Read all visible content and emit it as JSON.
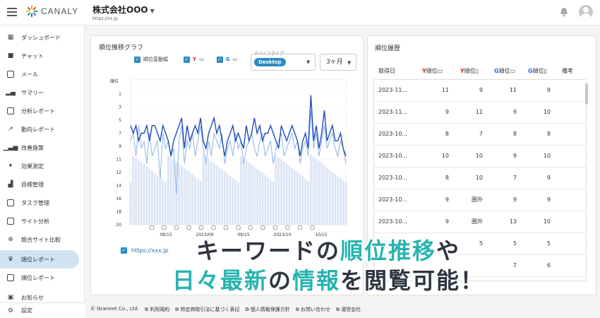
{
  "header": {
    "brand": "CANALY",
    "company": "株式会社OOO",
    "url": "https://xx.jp"
  },
  "sidebar": {
    "items": [
      {
        "label": "ダッシュボード",
        "icon": "grid-icon"
      },
      {
        "label": "チャット",
        "icon": "chat-icon"
      },
      {
        "label": "メール",
        "icon": "mail-icon"
      },
      {
        "label": "サマリー",
        "icon": "bar-chart-icon"
      },
      {
        "label": "分析レポート",
        "icon": "report-icon"
      },
      {
        "label": "動向レポート",
        "icon": "trend-icon"
      },
      {
        "label": "改善施策",
        "icon": "improve-icon"
      },
      {
        "label": "効果測定",
        "icon": "measure-icon"
      },
      {
        "label": "目標管理",
        "icon": "goal-icon"
      },
      {
        "label": "タスク管理",
        "icon": "task-icon"
      },
      {
        "label": "サイト分析",
        "icon": "site-icon"
      },
      {
        "label": "競合サイト比較",
        "icon": "compare-icon"
      },
      {
        "label": "順位レポート",
        "icon": "crown-icon",
        "active": true
      },
      {
        "label": "順位レポート",
        "icon": "edit-icon"
      },
      {
        "label": "お知らせ",
        "icon": "notice-icon"
      }
    ],
    "settings": "設定"
  },
  "rank_chart_card": {
    "title": "順位推移グラフ",
    "legend": {
      "rank_range": "順位変動幅",
      "yahoo_mark": "Y",
      "google_mark": "G"
    },
    "device_label": "デバイスタイプ",
    "device_value": "Desktop",
    "period_value": "3ヶ月",
    "series_url": "https://xxx.jp"
  },
  "chart_data": {
    "type": "line",
    "ylabel": "順位",
    "y_reversed": true,
    "ylim": [
      1,
      20
    ],
    "y_ticks": [
      "1",
      "3",
      "5",
      "7",
      "9",
      "11",
      "12",
      "14",
      "16",
      "18",
      "20"
    ],
    "x_ticks": [
      "08/15",
      "2023/09",
      "09/15",
      "2023/10",
      "10/15"
    ],
    "series": [
      {
        "color": "#1f4db8",
        "values": [
          7,
          8,
          7,
          9,
          8,
          8,
          7,
          9,
          7,
          7,
          8,
          9,
          7,
          8,
          9,
          11,
          9,
          8,
          7,
          6,
          10,
          7,
          9,
          8,
          7,
          8,
          6,
          9,
          10,
          8,
          7,
          6,
          8,
          7,
          9,
          11,
          9,
          8,
          7,
          9,
          8,
          9,
          10,
          7,
          9,
          8,
          6,
          8,
          7,
          9,
          8,
          8,
          7,
          8,
          9,
          10,
          7,
          8,
          9,
          8,
          7,
          8,
          9,
          11,
          9,
          8,
          10,
          3,
          9,
          7,
          10,
          8,
          5,
          9,
          8,
          7,
          9,
          9,
          8,
          10,
          11
        ]
      },
      {
        "color": "#8fb4ec",
        "values": [
          9,
          8,
          11,
          7,
          10,
          9,
          12,
          8,
          11,
          10,
          9,
          14,
          8,
          10,
          9,
          11,
          10,
          16,
          9,
          7,
          12,
          9,
          10,
          8,
          11,
          9,
          7,
          10,
          12,
          9,
          11,
          8,
          9,
          10,
          8,
          12,
          10,
          9,
          11,
          8,
          10,
          9,
          12,
          10,
          9,
          8,
          10,
          11,
          9,
          8,
          11,
          10,
          9,
          12,
          10,
          9,
          8,
          11,
          10,
          9,
          8,
          10,
          9,
          12,
          10,
          9,
          11,
          5,
          10,
          8,
          11,
          9,
          7,
          10,
          9,
          8,
          10,
          11,
          9,
          10,
          12
        ]
      }
    ],
    "grid": true
  },
  "history_card": {
    "title": "順位履歴",
    "columns": {
      "date": "取得日",
      "y_pc": "順位",
      "y_sp": "順位",
      "g_pc": "順位",
      "g_sp": "順位",
      "note": "備考"
    },
    "rows": [
      {
        "date": "2023-11...",
        "y_pc": "11",
        "y_sp": "9",
        "g_pc": "11",
        "g_sp": "9"
      },
      {
        "date": "2023-11...",
        "y_pc": "9",
        "y_sp": "11",
        "g_pc": "9",
        "g_sp": "10"
      },
      {
        "date": "2023-10...",
        "y_pc": "8",
        "y_sp": "7",
        "g_pc": "8",
        "g_sp": "8"
      },
      {
        "date": "2023-10...",
        "y_pc": "10",
        "y_sp": "10",
        "g_pc": "9",
        "g_sp": "10"
      },
      {
        "date": "2023-10...",
        "y_pc": "8",
        "y_sp": "10",
        "g_pc": "7",
        "g_sp": "9"
      },
      {
        "date": "2023-10...",
        "y_pc": "9",
        "y_sp": "圏外",
        "g_pc": "9",
        "g_sp": "9"
      },
      {
        "date": "2023-10...",
        "y_pc": "9",
        "y_sp": "圏外",
        "g_pc": "13",
        "g_sp": "10"
      },
      {
        "date": "",
        "y_pc": "",
        "y_sp": "5",
        "g_pc": "5",
        "g_sp": "5"
      },
      {
        "date": "",
        "y_pc": "",
        "y_sp": "",
        "g_pc": "7",
        "g_sp": "6"
      }
    ]
  },
  "banner": {
    "line1_a": "キーワードの",
    "line1_b": "順位推移",
    "line1_c": "や",
    "line2_a": "日々最新",
    "line2_b": "の",
    "line2_c": "情報",
    "line2_d": "を閲覧可能！"
  },
  "footer": {
    "copyright": "© Grannet Co., Ltd.",
    "links": [
      "利用規約",
      "特定商取引法に基づく表記",
      "個人情報保護方針",
      "お問い合わせ",
      "運営会社"
    ]
  },
  "colors": {
    "accent": "#2b8cc4",
    "banner_highlight": "#27b4b0",
    "active_nav": "#cfe3f3"
  }
}
